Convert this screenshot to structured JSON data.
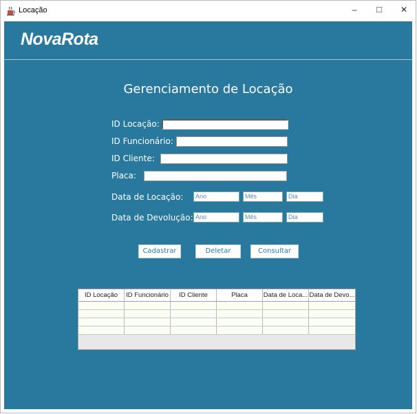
{
  "window": {
    "title": "Locação",
    "app_icon": "java-cup-icon"
  },
  "window_controls": {
    "minimize": "–",
    "maximize": "□",
    "close": "✕"
  },
  "brand": {
    "logo": "NovaRota"
  },
  "page": {
    "heading": "Gerenciamento de Locação"
  },
  "form": {
    "id_locacao_label": "ID Locação:",
    "id_funcionario_label": "ID Funcionário:",
    "id_cliente_label": "ID Cliente:",
    "placa_label": "Placa:",
    "data_locacao_label": "Data de Locação:",
    "data_devolucao_label": "Data de Devolução:",
    "ano_placeholder": "Ano",
    "mes_placeholder": "Mês",
    "dia_placeholder": "Dia"
  },
  "buttons": {
    "cadastrar": "Cadastrar",
    "deletar": "Deletar",
    "consultar": "Consultar"
  },
  "table": {
    "columns": [
      "ID Locação",
      "ID Funcionário",
      "ID Cliente",
      "Placa",
      "Data de Loca...",
      "Data de Devo..."
    ],
    "rows": [
      [
        "",
        "",
        "",
        "",
        "",
        ""
      ],
      [
        "",
        "",
        "",
        "",
        "",
        ""
      ],
      [
        "",
        "",
        "",
        "",
        "",
        ""
      ],
      [
        "",
        "",
        "",
        "",
        "",
        ""
      ]
    ]
  },
  "colors": {
    "background": "#29789e",
    "button_text": "#2a7aaf"
  }
}
